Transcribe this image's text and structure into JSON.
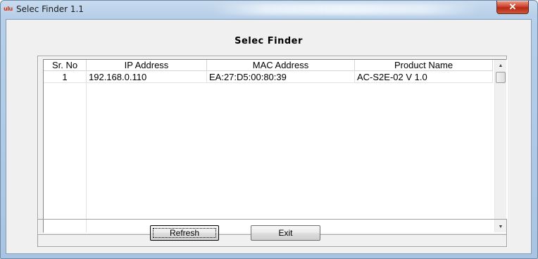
{
  "window": {
    "title": "Selec Finder 1.1",
    "icon_text": "ulu",
    "close_glyph": "✕"
  },
  "main": {
    "heading": "Selec Finder"
  },
  "table": {
    "columns": [
      "Sr. No",
      "IP Address",
      "MAC Address",
      "Product Name"
    ],
    "rows": [
      {
        "sr": "1",
        "ip": "192.168.0.110",
        "mac": "EA:27:D5:00:80:39",
        "product": "AC-S2E-02 V 1.0"
      }
    ]
  },
  "scrollbar": {
    "up_glyph": "▲",
    "down_glyph": "▼"
  },
  "buttons": {
    "refresh_label": "Refresh",
    "exit_label": "Exit"
  },
  "colors": {
    "close_button": "#c9452f",
    "frame": "#a9c4e2",
    "client": "#f0f0f0"
  }
}
